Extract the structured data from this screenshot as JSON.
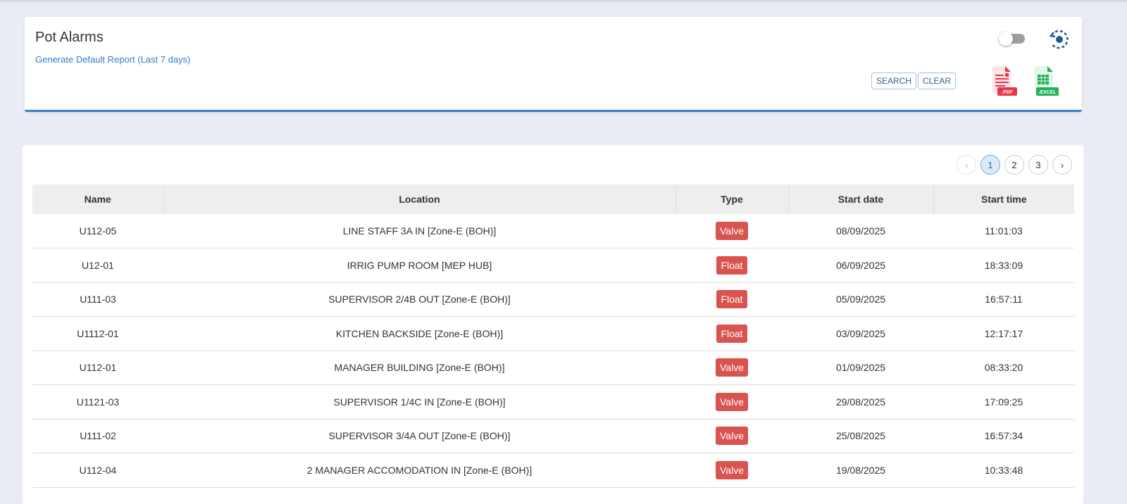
{
  "header": {
    "title": "Pot Alarms",
    "report_link": "Generate Default Report (Last 7 days)",
    "search_label": "SEARCH",
    "clear_label": "CLEAR",
    "pdf_label": ".PDF",
    "excel_label": ".EXCEL"
  },
  "pagination": {
    "prev": "‹",
    "pages": [
      "1",
      "2",
      "3"
    ],
    "next": "›",
    "current": "1"
  },
  "colors": {
    "badge": "#d9534f",
    "accent": "#3a7fcf"
  },
  "table": {
    "columns": [
      "Name",
      "Location",
      "Type",
      "Start date",
      "Start time"
    ],
    "rows": [
      [
        "U112-05",
        "LINE STAFF 3A IN [Zone-E (BOH)]",
        "Valve",
        "08/09/2025",
        "11:01:03"
      ],
      [
        "U12-01",
        "IRRIG PUMP ROOM [MEP HUB]",
        "Float",
        "06/09/2025",
        "18:33:09"
      ],
      [
        "U111-03",
        "SUPERVISOR 2/4B OUT [Zone-E (BOH)]",
        "Float",
        "05/09/2025",
        "16:57:11"
      ],
      [
        "U1112-01",
        "KITCHEN BACKSIDE [Zone-E (BOH)]",
        "Float",
        "03/09/2025",
        "12:17:17"
      ],
      [
        "U112-01",
        "MANAGER BUILDING [Zone-E (BOH)]",
        "Valve",
        "01/09/2025",
        "08:33:20"
      ],
      [
        "U1121-03",
        "SUPERVISOR 1/4C IN [Zone-E (BOH)]",
        "Valve",
        "29/08/2025",
        "17:09:25"
      ],
      [
        "U111-02",
        "SUPERVISOR 3/4A OUT [Zone-E (BOH)]",
        "Valve",
        "25/08/2025",
        "16:57:34"
      ],
      [
        "U112-04",
        "2 MANAGER ACCOMODATION IN [Zone-E (BOH)]",
        "Valve",
        "19/08/2025",
        "10:33:48"
      ]
    ]
  }
}
